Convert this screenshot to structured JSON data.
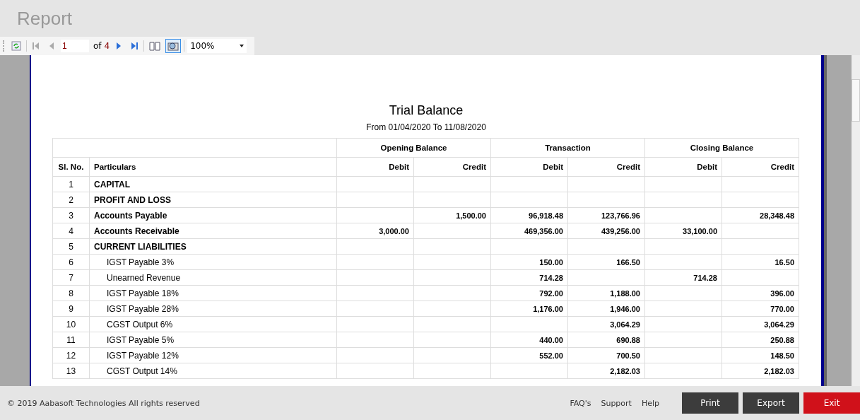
{
  "window": {
    "title": "Report"
  },
  "toolbar": {
    "page": "1",
    "of_label": "of",
    "page_count": "4",
    "view_buttons": [
      {
        "kind": "book",
        "selected": false
      },
      {
        "kind": "layout",
        "selected": true
      }
    ],
    "zoom": "100%"
  },
  "report": {
    "title": "Trial Balance",
    "subtitle": "From 01/04/2020  To 11/08/2020",
    "groups": [
      "Opening Balance",
      "Transaction",
      "Closing Balance"
    ],
    "columns": [
      "Sl. No.",
      "Particulars",
      "Debit",
      "Credit",
      "Debit",
      "Credit",
      "Debit",
      "Credit"
    ],
    "rows": [
      {
        "no": "1",
        "name": "CAPITAL"
      },
      {
        "no": "2",
        "name": "PROFIT AND LOSS"
      },
      {
        "no": "3",
        "name": "Accounts Payable",
        "opening_credit": "1,500.00",
        "transaction_debit": "96,918.48",
        "transaction_credit": "123,766.96",
        "closing_credit": "28,348.48"
      },
      {
        "no": "4",
        "name": "Accounts Receivable",
        "opening_debit": "3,000.00",
        "transaction_debit": "469,356.00",
        "transaction_credit": "439,256.00",
        "closing_debit": "33,100.00"
      },
      {
        "no": "5",
        "name": "CURRENT LIABILITIES",
        "children": [
          {
            "no": "6",
            "name": "IGST Payable 3%",
            "transaction_debit": "150.00",
            "transaction_credit": "166.50",
            "closing_credit": "16.50"
          },
          {
            "no": "7",
            "name": "Unearned Revenue",
            "transaction_debit": "714.28",
            "closing_debit": "714.28"
          },
          {
            "no": "8",
            "name": "IGST Payable 18%",
            "transaction_debit": "792.00",
            "transaction_credit": "1,188.00",
            "closing_credit": "396.00"
          },
          {
            "no": "9",
            "name": "IGST Payable 28%",
            "transaction_debit": "1,176.00",
            "transaction_credit": "1,946.00",
            "closing_credit": "770.00"
          },
          {
            "no": "10",
            "name": "CGST Output 6%",
            "transaction_credit": "3,064.29",
            "closing_credit": "3,064.29"
          },
          {
            "no": "11",
            "name": "IGST Payable 5%",
            "transaction_debit": "440.00",
            "transaction_credit": "690.88",
            "closing_credit": "250.88"
          },
          {
            "no": "12",
            "name": "IGST Payable 12%",
            "transaction_debit": "552.00",
            "transaction_credit": "700.50",
            "closing_credit": "148.50"
          },
          {
            "no": "13",
            "name": "CGST Output 14%",
            "transaction_credit": "2,182.03",
            "closing_credit": "2,182.03"
          }
        ]
      }
    ]
  },
  "footer": {
    "copyright": "© 2019 Aabasoft Technologies All rights reserved",
    "links": [
      "FAQ's",
      "Support",
      "Help"
    ],
    "buttons": [
      {
        "label": "Print",
        "kind": "dark"
      },
      {
        "label": "Export",
        "kind": "dark"
      },
      {
        "label": "Exit",
        "kind": "danger"
      }
    ]
  }
}
